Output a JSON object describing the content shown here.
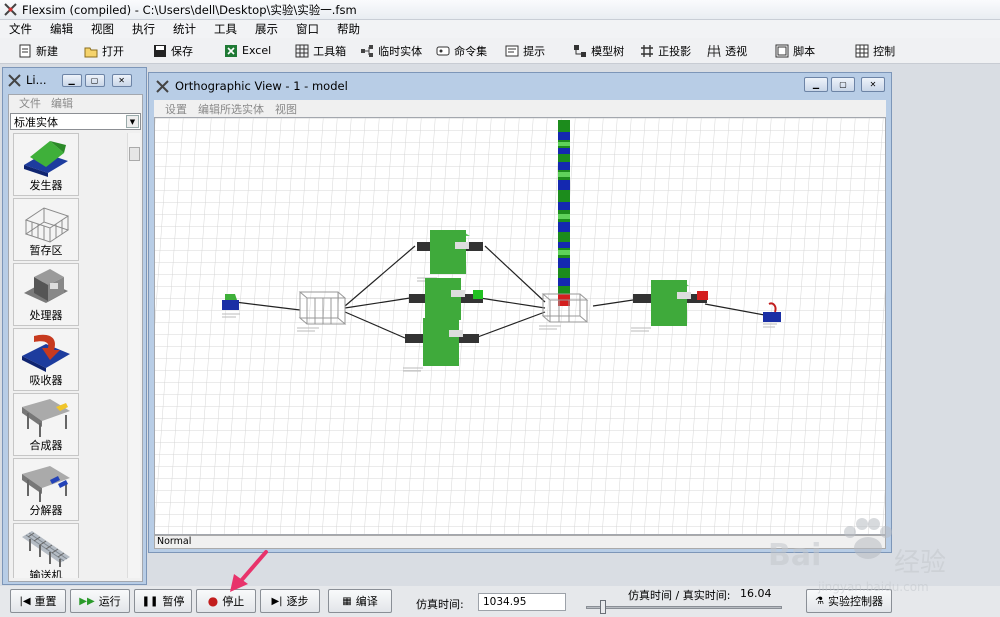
{
  "app": {
    "title": "Flexsim (compiled) - C:\\Users\\dell\\Desktop\\实验\\实验一.fsm"
  },
  "menu": [
    "文件",
    "编辑",
    "视图",
    "执行",
    "统计",
    "工具",
    "展示",
    "窗口",
    "帮助"
  ],
  "toolbar": {
    "new": "新建",
    "open": "打开",
    "save": "保存",
    "excel": "Excel",
    "toolbox": "工具箱",
    "temp_entity": "临时实体",
    "command_set": "命令集",
    "hint": "提示",
    "model_tree": "模型树",
    "ortho_proj": "正投影",
    "perspective": "透视",
    "script": "脚本",
    "control": "控制"
  },
  "library": {
    "title": "Li...",
    "menu": [
      "文件",
      "编辑"
    ],
    "combo_value": "标准实体",
    "items": [
      "发生器",
      "暂存区",
      "处理器",
      "吸收器",
      "合成器",
      "分解器",
      "输送机"
    ]
  },
  "ortho": {
    "title": "Orthographic View - 1 - model",
    "menu": [
      "设置",
      "编辑所选实体",
      "视图"
    ],
    "status": "Normal"
  },
  "controls": {
    "reset": "重置",
    "run": "运行",
    "pause": "暂停",
    "stop": "停止",
    "step": "逐步",
    "compile": "编译",
    "sim_time_label": "仿真时间:",
    "sim_time_value": "1034.95",
    "ratio_label": "仿真时间 / 真实时间:",
    "ratio_value": "16.04",
    "experimenter": "实验控制器"
  },
  "watermark": {
    "brand": "Bai",
    "brand_cn": "经验",
    "url": "jingyan.baidu.com"
  },
  "colors": {
    "accent_green": "#4caf3a",
    "accent_blue": "#1a2fa5",
    "stop_red": "#c21d1d",
    "arrow_pink": "#e8336b"
  }
}
